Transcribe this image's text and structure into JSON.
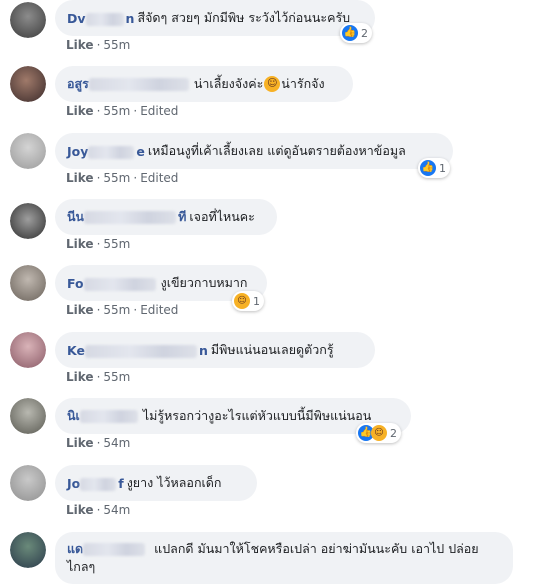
{
  "comments": [
    {
      "name_start": "Dv",
      "name_end": "n",
      "text": "สีจัดๆ สวยๆ มักมีพิษ ระวังไว้ก่อนนะครับ",
      "like": "Like",
      "time": "55m",
      "edited": "",
      "reaction_count": "2"
    },
    {
      "name_start": "อสูร",
      "name_end": "",
      "text": "น่าเลี้ยงจังค่ะ",
      "text_after": "น่ารักจัง",
      "like": "Like",
      "time": "55m",
      "edited": "Edited"
    },
    {
      "name_start": "Joy",
      "name_end": "e",
      "text": "เหมือนงูที่เค้าเลี้ยงเลย แต่ดูอันตรายต้องหาข้อมูล",
      "like": "Like",
      "time": "55m",
      "edited": "Edited",
      "reaction_count": "1"
    },
    {
      "name_start": "นีน",
      "name_end": "ที",
      "text": "เจอที่ไหนคะ",
      "like": "Like",
      "time": "55m",
      "edited": ""
    },
    {
      "name_start": "Fo",
      "name_end": "",
      "text": "งูเขียวกาบหมาก",
      "like": "Like",
      "time": "55m",
      "edited": "Edited",
      "reaction_count": "1"
    },
    {
      "name_start": "Ke",
      "name_end": "n",
      "text": "มีพิษแน่นอนเลยดูตัวกรู้",
      "like": "Like",
      "time": "55m",
      "edited": ""
    },
    {
      "name_start": "นิเ",
      "name_end": "",
      "text": "ไม่รู้หรอกว่างูอะไรแต่หัวแบบนี้มีพิษแน่นอน",
      "like": "Like",
      "time": "54m",
      "edited": "",
      "reaction_count": "2"
    },
    {
      "name_start": "Jo",
      "name_end": "f",
      "text": "งูยาง ไว้หลอกเด็ก",
      "like": "Like",
      "time": "54m",
      "edited": ""
    },
    {
      "name_start": "แด",
      "name_end": "",
      "text": "แปลกดี มันมาให้โชคหรือเปล่า อย่าฆ่ามันนะคับ เอาไป ปล่อยไกลๆ",
      "like": "",
      "time": "",
      "edited": ""
    }
  ],
  "separator": "·",
  "colors": {
    "bubble_bg": "#f0f2f5",
    "name": "#385898",
    "meta": "#606770",
    "like_blue": "#1877f2",
    "haha_yellow": "#f7b125"
  },
  "icons": {
    "like_reaction": "thumbs-up-icon",
    "haha_reaction": "laughing-face-icon",
    "smile_emoji": "smiling-face-icon"
  }
}
